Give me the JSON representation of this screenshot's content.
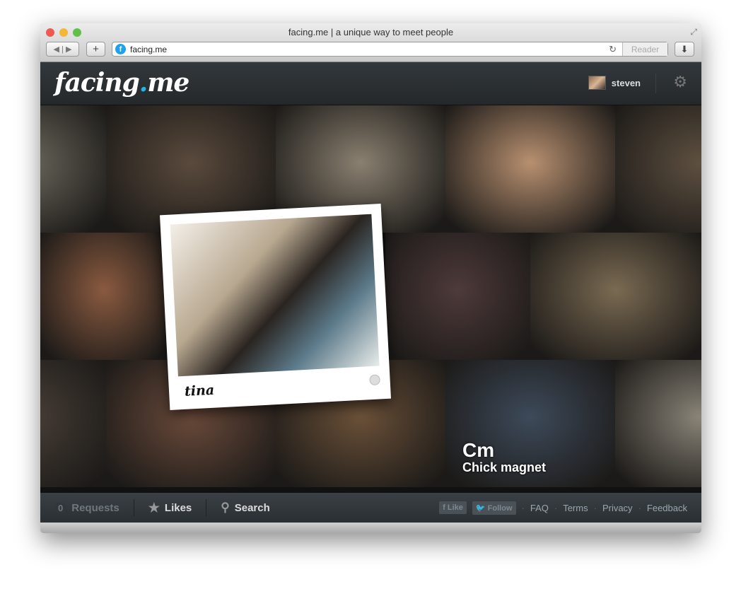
{
  "browser": {
    "title": "facing.me | a unique way to meet people",
    "url": "facing.me",
    "reader_label": "Reader"
  },
  "header": {
    "logo_main": "facing",
    "logo_dot": ".",
    "logo_tld": "me",
    "username": "steven"
  },
  "colors": {
    "accent": "#1fb5e8",
    "header_bg": "#2b3033"
  },
  "photos": [
    {
      "row": 1,
      "col": 0,
      "color": "#6d6a5e"
    },
    {
      "row": 1,
      "col": 1,
      "color": "#5a4a3c"
    },
    {
      "row": 1,
      "col": 2,
      "color": "#8a8070"
    },
    {
      "row": 1,
      "col": 3,
      "color": "#b89070"
    },
    {
      "row": 1,
      "col": 4,
      "color": "#5e5040"
    },
    {
      "row": 2,
      "col": 0,
      "color": "#8a5a40"
    },
    {
      "row": 2,
      "col": 2,
      "color": "#4e3a3a"
    },
    {
      "row": 2,
      "col": 3,
      "color": "#7a6a52"
    },
    {
      "row": 3,
      "col": 0,
      "color": "#4a4038"
    },
    {
      "row": 3,
      "col": 1,
      "color": "#6a4a3a"
    },
    {
      "row": 3,
      "col": 2,
      "color": "#6a5038"
    },
    {
      "row": 3,
      "col": 3,
      "color": "#3d4a5a"
    },
    {
      "row": 3,
      "col": 4,
      "color": "#8a8478"
    }
  ],
  "photo_caption": {
    "line1": "Cm",
    "line2": "Chick magnet"
  },
  "featured": {
    "name": "tina"
  },
  "footer": {
    "requests_count": "0",
    "requests_label": "Requests",
    "likes_label": "Likes",
    "search_label": "Search",
    "facebook_label": "Like",
    "twitter_label": "Follow",
    "links": [
      "FAQ",
      "Terms",
      "Privacy",
      "Feedback"
    ]
  }
}
